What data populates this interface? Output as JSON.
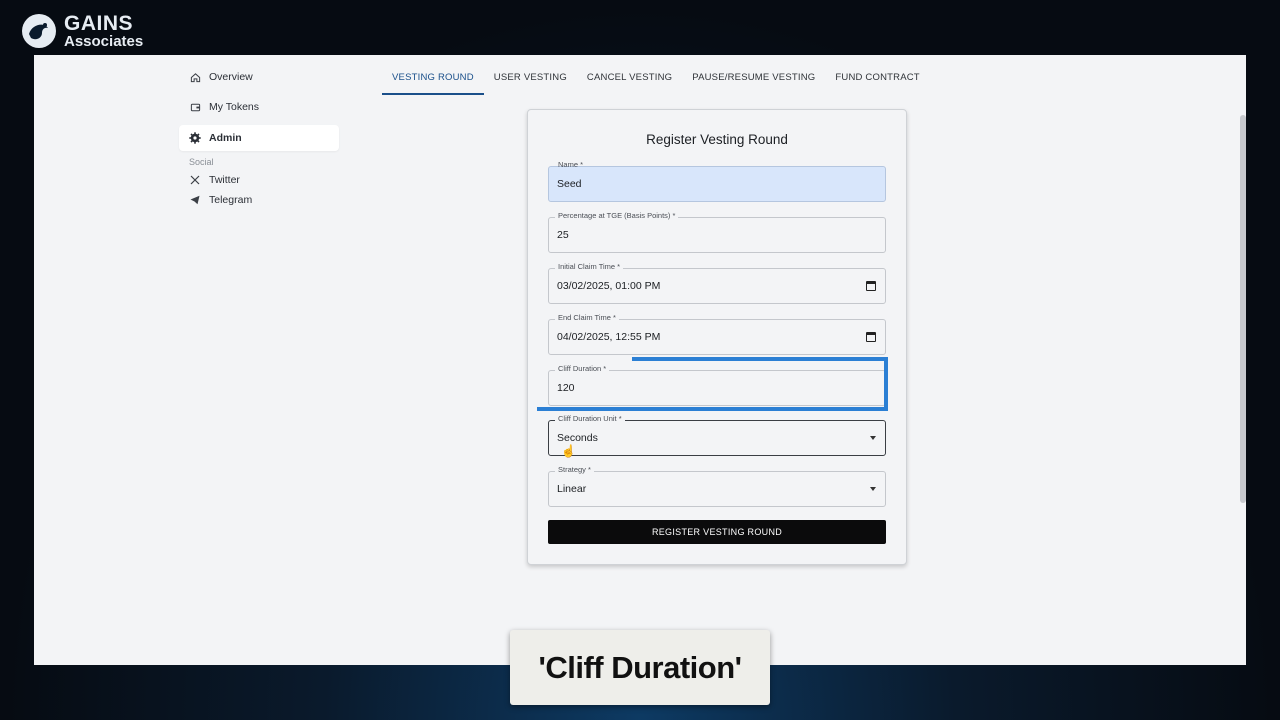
{
  "brand": {
    "line1": "GAINS",
    "line2": "Associates"
  },
  "sidebar": {
    "items": [
      {
        "label": "Overview",
        "icon": "home-icon"
      },
      {
        "label": "My Tokens",
        "icon": "wallet-icon"
      },
      {
        "label": "Admin",
        "icon": "gear-icon",
        "active": true
      }
    ],
    "section_label": "Social",
    "social": [
      {
        "label": "Twitter",
        "icon": "x-icon"
      },
      {
        "label": "Telegram",
        "icon": "telegram-icon"
      }
    ]
  },
  "tabs": [
    {
      "label": "VESTING ROUND",
      "active": true
    },
    {
      "label": "USER VESTING"
    },
    {
      "label": "CANCEL VESTING"
    },
    {
      "label": "PAUSE/RESUME VESTING"
    },
    {
      "label": "FUND CONTRACT"
    }
  ],
  "form": {
    "title": "Register Vesting Round",
    "fields": {
      "name": {
        "label": "Name *",
        "value": "Seed"
      },
      "tge": {
        "label": "Percentage at TGE (Basis Points) *",
        "value": "25"
      },
      "initial_claim": {
        "label": "Initial Claim Time *",
        "value": "03/02/2025, 01:00 PM"
      },
      "end_claim": {
        "label": "End Claim Time *",
        "value": "04/02/2025, 12:55 PM"
      },
      "cliff_duration": {
        "label": "Cliff Duration *",
        "value": "120"
      },
      "cliff_unit": {
        "label": "Cliff Duration Unit *",
        "value": "Seconds"
      },
      "strategy": {
        "label": "Strategy *",
        "value": "Linear"
      }
    },
    "submit_label": "REGISTER VESTING ROUND"
  },
  "caption": "'Cliff Duration'",
  "colors": {
    "accent": "#1a4f8a",
    "highlight": "#2b7fd4",
    "filled_field": "#d8e6fb"
  }
}
